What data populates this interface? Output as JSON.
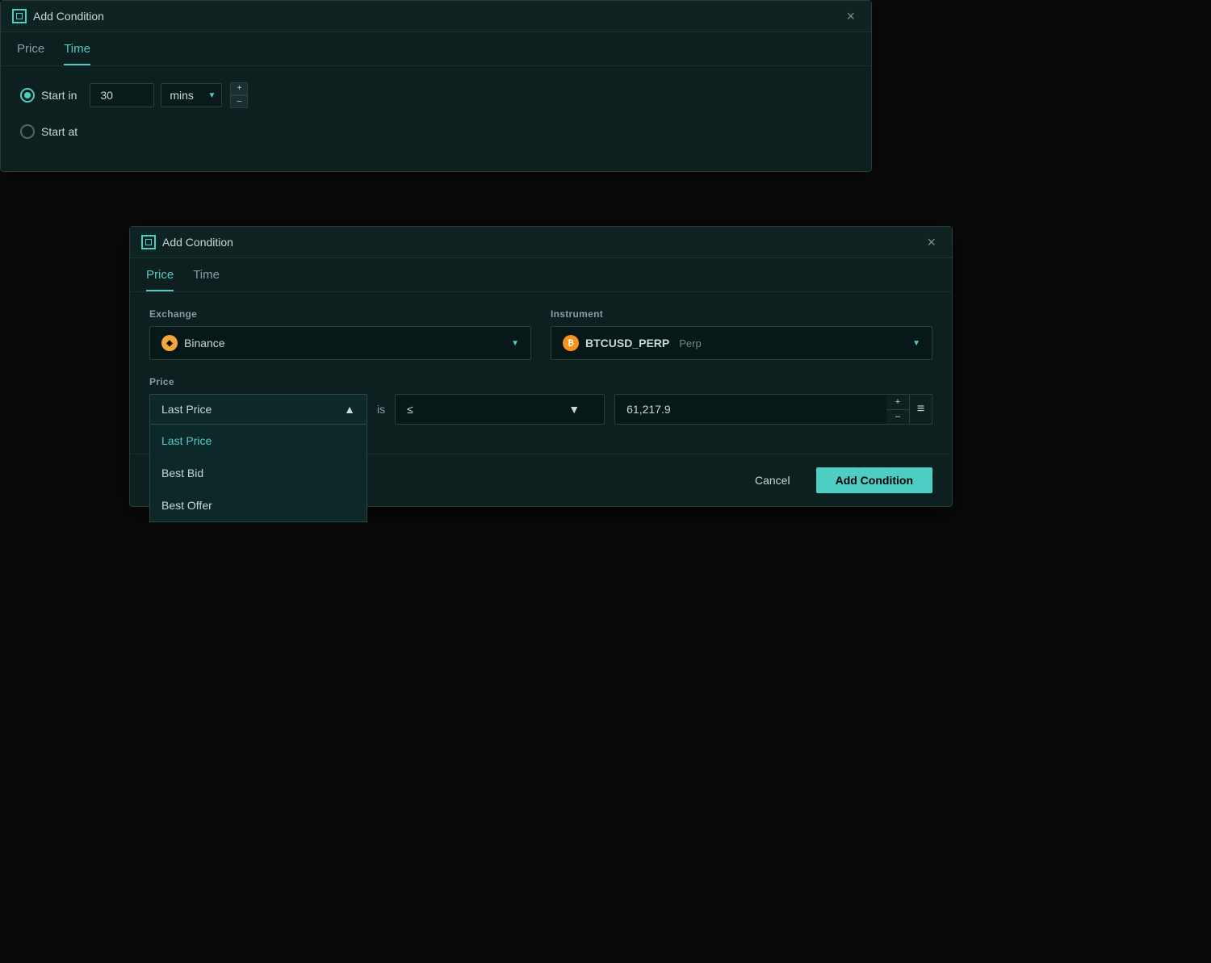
{
  "background": {
    "title": "Add Condition",
    "tabs": [
      {
        "id": "price",
        "label": "Price",
        "active": false
      },
      {
        "id": "time",
        "label": "Time",
        "active": true
      }
    ],
    "start_in_label": "Start in",
    "start_at_label": "Start at",
    "start_in_value": "30",
    "start_in_unit": "mins",
    "start_in_unit_arrow": "▼",
    "stepper_plus": "+",
    "stepper_minus": "–"
  },
  "foreground": {
    "title": "Add Condition",
    "close_label": "×",
    "tabs": [
      {
        "id": "price",
        "label": "Price",
        "active": true
      },
      {
        "id": "time",
        "label": "Time",
        "active": false
      }
    ],
    "exchange_section": {
      "label": "Exchange",
      "selected": "Binance",
      "arrow": "▼"
    },
    "instrument_section": {
      "label": "Instrument",
      "name": "BTCUSD_PERP",
      "type": "Perp",
      "arrow": "▼"
    },
    "price_section": {
      "label": "Price",
      "dropdown": {
        "selected": "Last Price",
        "arrow_up": "▲",
        "options": [
          {
            "label": "Last Price",
            "selected": true
          },
          {
            "label": "Best Bid",
            "selected": false
          },
          {
            "label": "Best Offer",
            "selected": false
          }
        ]
      },
      "is_label": "is",
      "comparator": {
        "symbol": "≤",
        "arrow": "▼"
      },
      "value": "61,217.9",
      "stepper_plus": "+",
      "stepper_minus": "–",
      "menu_icon": "≡"
    },
    "footer": {
      "cancel_label": "Cancel",
      "add_label": "Add Condition"
    }
  },
  "logo_icon": "⊞"
}
